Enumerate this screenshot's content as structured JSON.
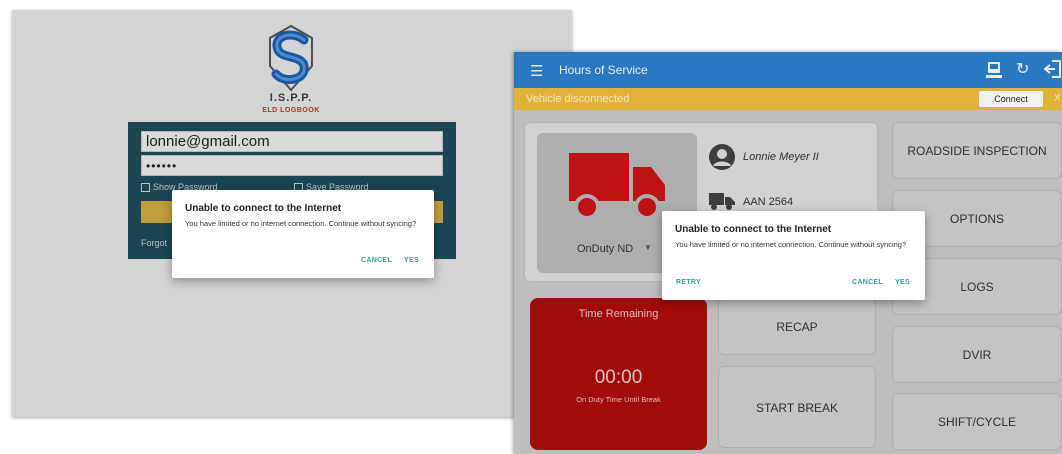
{
  "login_screen": {
    "logo": {
      "title": "I.S.P.P.",
      "subtitle": "ELD LOGBOOK",
      "icon": "isp-logo"
    },
    "email_value": "lonnie@gmail.com",
    "password_mask": "••••••",
    "show_password_label": "Show Password",
    "save_password_label": "Save Password",
    "forgot_label": "Forgot"
  },
  "dialog_login": {
    "title": "Unable to connect to the Internet",
    "message": "You have limited or no internet connection. Continue without syncing?",
    "cancel": "CANCEL",
    "yes": "YES"
  },
  "hos_screen": {
    "app_title": "Hours of Service",
    "menu_icon": "hamburger-icon",
    "toolbar_icons": [
      "eld-device-icon",
      "refresh-icon",
      "logout-icon"
    ],
    "banner": {
      "text": "Vehicle disconnected",
      "connect": "Connect",
      "close": "X"
    },
    "duty_status": "OnDuty ND",
    "driver_name": "Lonnie Meyer II",
    "truck_id": "AAN 2564",
    "time": {
      "label": "Time Remaining",
      "value": "00:00",
      "sub": "On Duty Time Until Break"
    },
    "buttons": {
      "recap": "RECAP",
      "start_break": "START BREAK",
      "roadside": "ROADSIDE INSPECTION",
      "options": "OPTIONS",
      "logs": "LOGS",
      "dvir": "DVIR",
      "shift": "SHIFT/CYCLE"
    },
    "colors": {
      "app_bar": "#2a78bf",
      "banner": "#e1b23a",
      "time_card": "#b00c0c",
      "truck": "#d01515",
      "dialog_button": "#26a69a"
    }
  },
  "dialog_hos": {
    "title": "Unable to connect to the Internet",
    "message": "You have limited or no internet connection. Continue without syncing?",
    "retry": "RETRY",
    "cancel": "CANCEL",
    "yes": "YES"
  }
}
